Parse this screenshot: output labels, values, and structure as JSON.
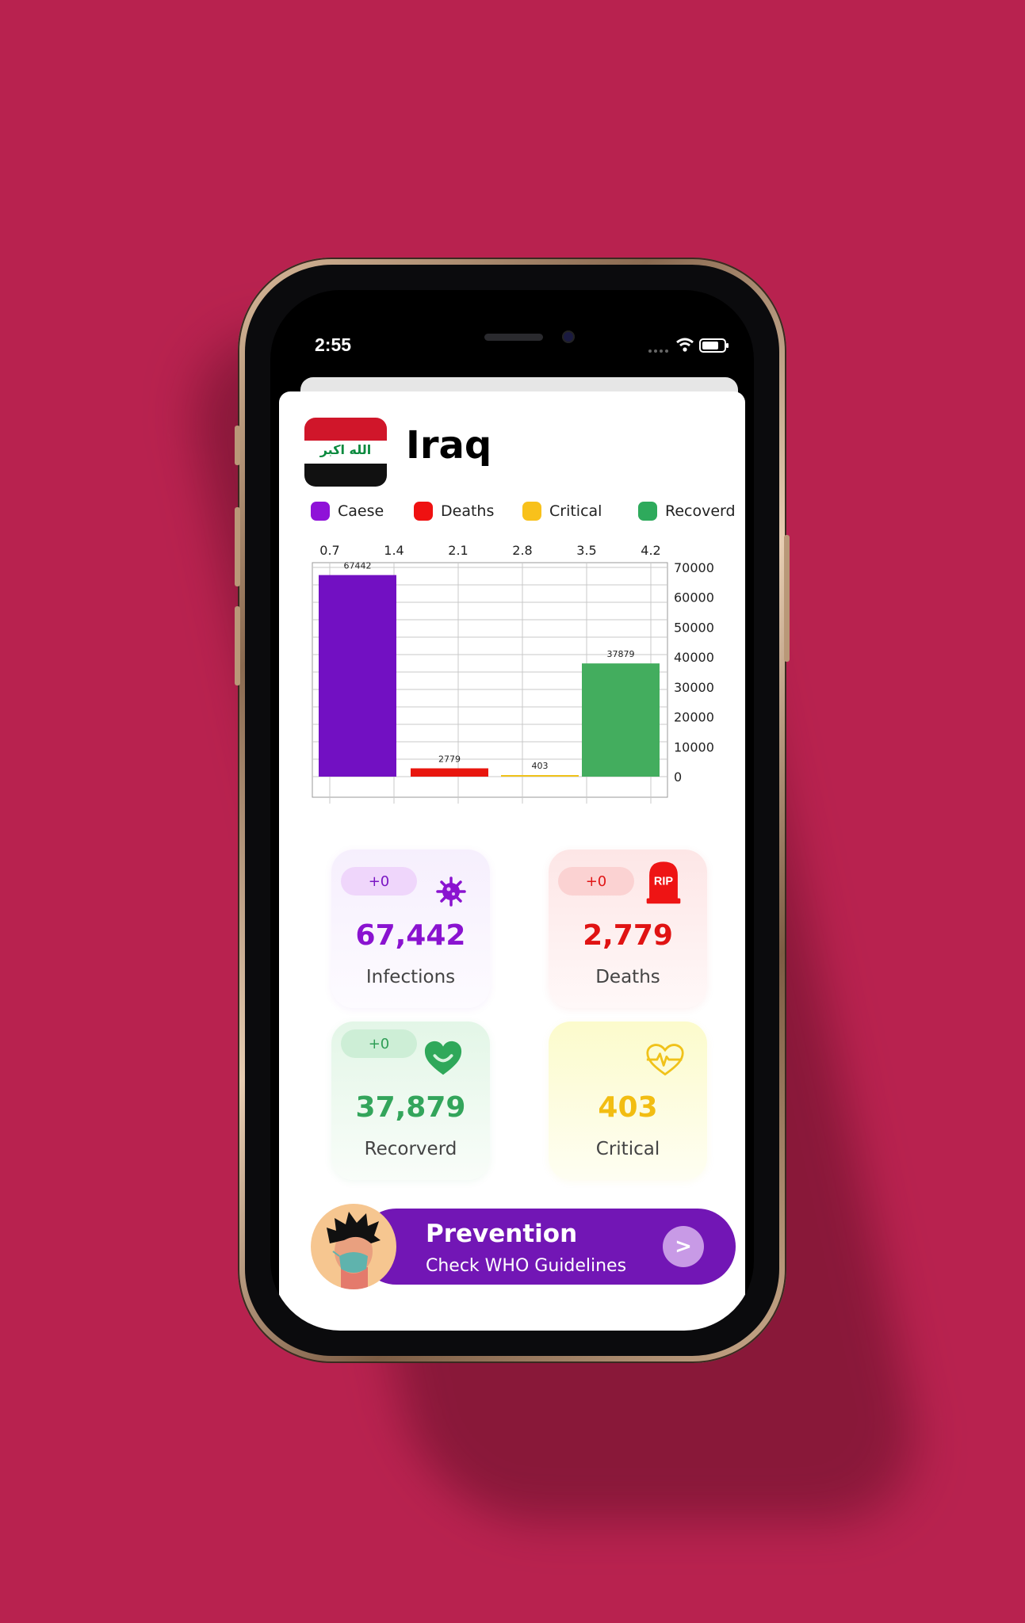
{
  "status_bar": {
    "time": "2:55"
  },
  "country": {
    "name": "Iraq",
    "flag_script": "الله اكبر"
  },
  "legend": [
    {
      "label": "Caese",
      "color": "#8f12d8"
    },
    {
      "label": "Deaths",
      "color": "#ef1111"
    },
    {
      "label": "Critical",
      "color": "#f8c11b"
    },
    {
      "label": "Recoverd",
      "color": "#2eaa5c"
    }
  ],
  "chart_data": {
    "type": "bar",
    "categories": [
      "Caese",
      "Deaths",
      "Critical",
      "Recoverd"
    ],
    "values": [
      67442,
      2779,
      403,
      37879
    ],
    "value_labels": [
      "67442",
      "2779",
      "403",
      "37879"
    ],
    "colors": [
      "#7210c2",
      "#e8160e",
      "#f0c21a",
      "#43ad5e"
    ],
    "x_ticks": [
      "0.7",
      "1.4",
      "2.1",
      "2.8",
      "3.5",
      "4.2"
    ],
    "y_ticks": [
      "0",
      "10000",
      "20000",
      "30000",
      "40000",
      "50000",
      "60000",
      "70000"
    ],
    "ylim": [
      0,
      70000
    ],
    "grid": true
  },
  "cards": {
    "infections": {
      "delta": "+0",
      "value": "67,442",
      "label": "Infections",
      "icon": "virus-icon"
    },
    "deaths": {
      "delta": "+0",
      "value": "2,779",
      "label": "Deaths",
      "icon": "tombstone-rip-icon",
      "icon_text": "RIP"
    },
    "recovered": {
      "delta": "+0",
      "value": "37,879",
      "label": "Recorverd",
      "icon": "heart-smile-icon"
    },
    "critical": {
      "value": "403",
      "label": "Critical",
      "icon": "heart-pulse-icon"
    }
  },
  "prevention": {
    "title": "Prevention",
    "subtitle": "Check WHO Guidelines",
    "button": ">",
    "avatar_icon": "masked-person-avatar"
  }
}
